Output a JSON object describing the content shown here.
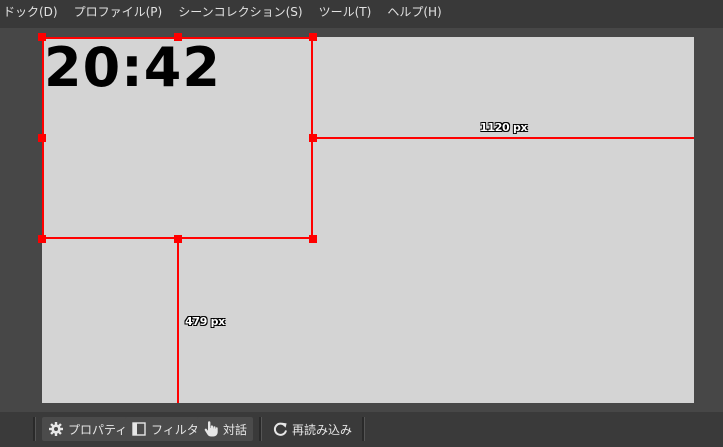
{
  "menu": {
    "items": [
      {
        "label": "ドック(D)"
      },
      {
        "label": "プロファイル(P)"
      },
      {
        "label": "シーンコレクション(S)"
      },
      {
        "label": "ツール(T)"
      },
      {
        "label": "ヘルプ(H)"
      }
    ]
  },
  "preview": {
    "clock_text": "20:42",
    "guide_horizontal_label": "1120 px",
    "guide_vertical_label": "479 px",
    "canvas_color": "#d4d4d4",
    "selection_color": "#ff0000"
  },
  "toolbar": {
    "properties": {
      "label": "プロパティ",
      "icon": "gear-icon"
    },
    "filters": {
      "label": "フィルタ",
      "icon": "filter-icon"
    },
    "interact": {
      "label": "対話",
      "icon": "hand-pointer-icon"
    },
    "reload": {
      "label": "再読み込み",
      "icon": "refresh-icon"
    }
  }
}
